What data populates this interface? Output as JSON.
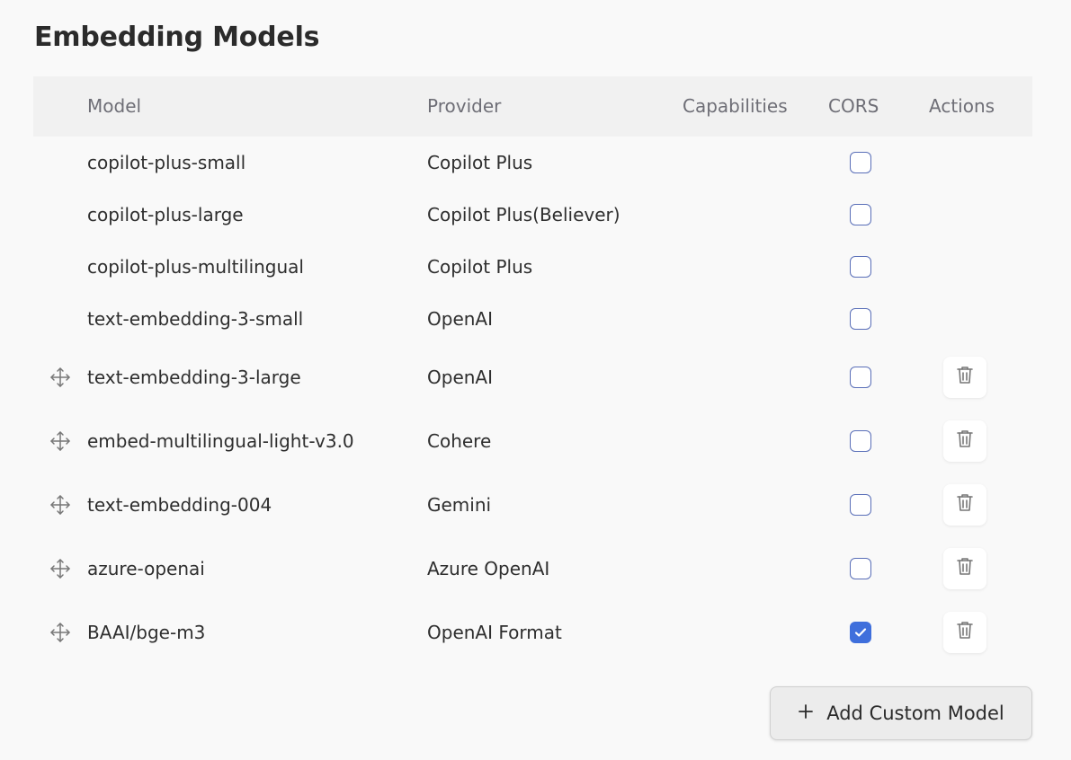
{
  "page": {
    "title": "Embedding Models"
  },
  "table": {
    "headers": {
      "model": "Model",
      "provider": "Provider",
      "capabilities": "Capabilities",
      "cors": "CORS",
      "actions": "Actions"
    },
    "rows": [
      {
        "model": "copilot-plus-small",
        "provider": "Copilot Plus",
        "cors": false,
        "draggable": false,
        "deletable": false
      },
      {
        "model": "copilot-plus-large",
        "provider": "Copilot Plus(Believer)",
        "cors": false,
        "draggable": false,
        "deletable": false
      },
      {
        "model": "copilot-plus-multilingual",
        "provider": "Copilot Plus",
        "cors": false,
        "draggable": false,
        "deletable": false
      },
      {
        "model": "text-embedding-3-small",
        "provider": "OpenAI",
        "cors": false,
        "draggable": false,
        "deletable": false
      },
      {
        "model": "text-embedding-3-large",
        "provider": "OpenAI",
        "cors": false,
        "draggable": true,
        "deletable": true
      },
      {
        "model": "embed-multilingual-light-v3.0",
        "provider": "Cohere",
        "cors": false,
        "draggable": true,
        "deletable": true
      },
      {
        "model": "text-embedding-004",
        "provider": "Gemini",
        "cors": false,
        "draggable": true,
        "deletable": true
      },
      {
        "model": "azure-openai",
        "provider": "Azure OpenAI",
        "cors": false,
        "draggable": true,
        "deletable": true
      },
      {
        "model": "BAAI/bge-m3",
        "provider": "OpenAI Format",
        "cors": true,
        "draggable": true,
        "deletable": true
      }
    ]
  },
  "actions": {
    "add_label": "Add Custom Model"
  },
  "icons": {
    "drag": "move-arrows-icon",
    "delete": "trash-icon",
    "add": "plus-icon",
    "check": "checkmark-icon"
  },
  "colors": {
    "accent": "#3f6fdc",
    "header_bg": "#f1f1f1",
    "checkbox_border": "#5a6fb8"
  }
}
